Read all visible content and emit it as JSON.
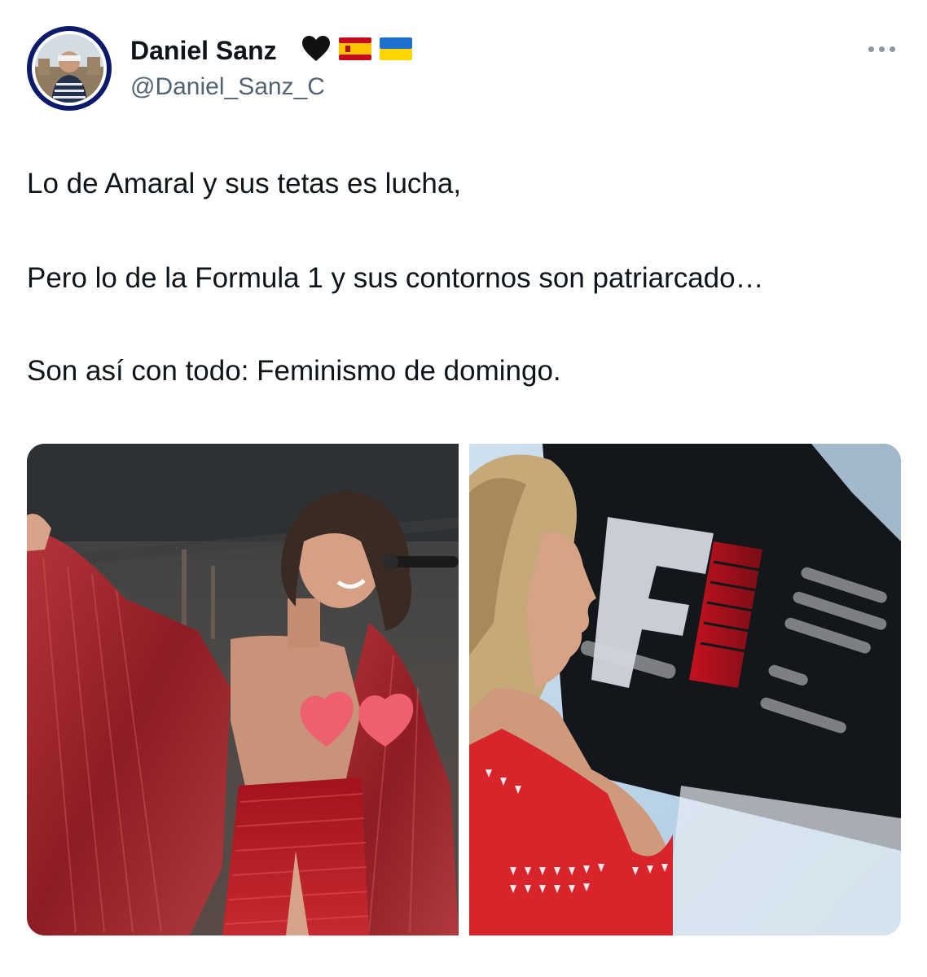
{
  "author": {
    "display_name": "Daniel Sanz",
    "handle": "@Daniel_Sanz_C",
    "badges": [
      "black-heart-icon",
      "spain-flag-icon",
      "ukraine-flag-icon"
    ]
  },
  "tweet": {
    "lines": [
      "Lo de Amaral y sus tetas es lucha,",
      "Pero lo de la Formula 1 y sus contornos son patriarcado…",
      "Son así con todo: Feminismo de domingo."
    ]
  },
  "media": {
    "images": [
      {
        "name": "concert-photo"
      },
      {
        "name": "formula1-photo"
      }
    ]
  },
  "colors": {
    "text": "#0f1419",
    "secondary": "#536471",
    "more_dots": "#8b98a5",
    "avatar_ring": "#0c1a6b"
  }
}
